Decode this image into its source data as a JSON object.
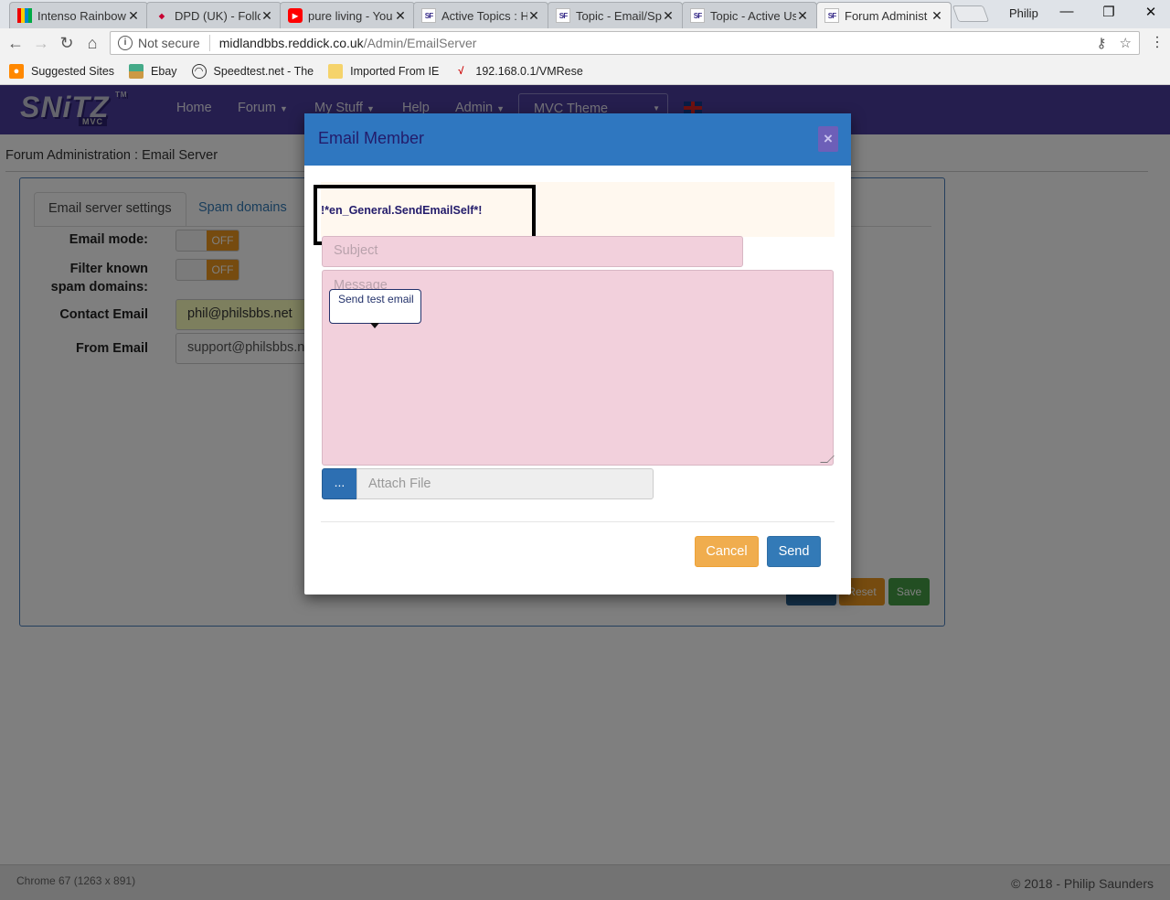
{
  "browser": {
    "tabs": [
      {
        "title": "Intenso Rainbow",
        "icon": "intenso-favicon"
      },
      {
        "title": "DPD (UK) - Follo",
        "icon": "dpd-favicon"
      },
      {
        "title": "pure living - You",
        "icon": "youtube-favicon"
      },
      {
        "title": "Active Topics : Hi",
        "icon": "snitz-favicon"
      },
      {
        "title": "Topic - Email/Sp",
        "icon": "snitz-favicon"
      },
      {
        "title": "Topic - Active Us",
        "icon": "snitz-favicon"
      },
      {
        "title": "Forum Administ",
        "icon": "snitz-favicon",
        "active": true
      }
    ],
    "profile_name": "Philip",
    "address": {
      "security_label": "Not secure",
      "host": "midlandbbs.reddick.co.uk",
      "path": "/Admin/EmailServer"
    },
    "bookmarks": [
      {
        "label": "Suggested Sites",
        "icon": "suggested-sites-icon"
      },
      {
        "label": "Ebay",
        "icon": "ebay-icon"
      },
      {
        "label": "Speedtest.net - The",
        "icon": "speedtest-icon"
      },
      {
        "label": "Imported From IE",
        "icon": "folder-icon"
      },
      {
        "label": "192.168.0.1/VMRese",
        "icon": "router-icon"
      }
    ]
  },
  "site": {
    "logo_text": "SNiTZ",
    "logo_sub": "MVC",
    "logo_tm": "TM",
    "nav": {
      "home": "Home",
      "forum": "Forum",
      "mystuff": "My Stuff",
      "help": "Help",
      "admin": "Admin",
      "theme": "MVC Theme"
    },
    "brand_color": "#4b3c9c"
  },
  "admin": {
    "breadcrumb": "Forum Administration : Email Server",
    "tabs": {
      "settings": "Email server settings",
      "spam": "Spam domains"
    },
    "email_mode_label": "Email mode:",
    "email_mode_state": "OFF",
    "filter_label_1": "Filter known",
    "filter_label_2": "spam domains:",
    "filter_state": "OFF",
    "contact_label": "Contact Email",
    "contact_value": "phil@philsbbs.net",
    "from_label": "From Email",
    "from_value": "support@philsbbs.net",
    "reset_label": "Reset",
    "save_label": "Save"
  },
  "modal": {
    "title": "Email Member",
    "close_icon": "×",
    "notice": "!*en_General.SendEmailSelf*!",
    "subject_placeholder": "Subject",
    "message_placeholder": "Message",
    "tooltip": "Send test email",
    "attach_button": "...",
    "attach_placeholder": "Attach File",
    "cancel_label": "Cancel",
    "send_label": "Send"
  },
  "footer": {
    "left": "Chrome 67 (1263 x 891)",
    "right": "© 2018 - Philip Saunders"
  }
}
